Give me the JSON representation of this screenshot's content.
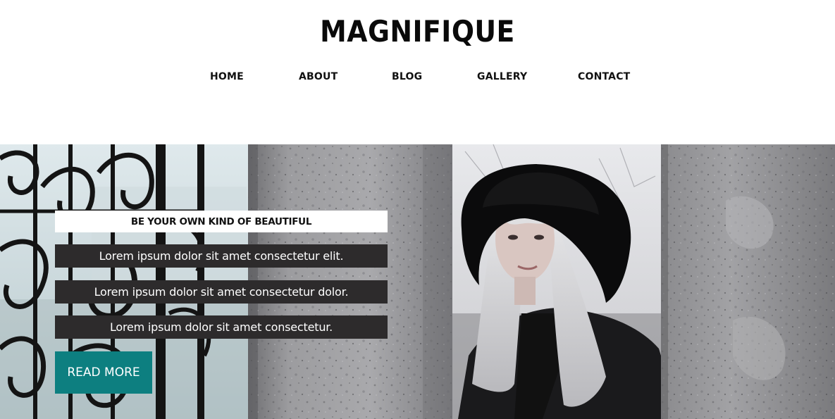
{
  "site": {
    "logo": "MAGNIFIQUE"
  },
  "nav": {
    "items": [
      "HOME",
      "ABOUT",
      "BLOG",
      "GALLERY",
      "CONTACT"
    ]
  },
  "hero": {
    "tagline": "BE YOUR OWN KIND OF BEAUTIFUL",
    "lines": [
      "Lorem ipsum dolor sit amet consectetur elit.",
      "Lorem ipsum dolor sit amet consectetur dolor.",
      "Lorem ipsum dolor sit amet consectetur."
    ],
    "button_label": "READ MORE"
  },
  "colors": {
    "accent": "#0d7f80",
    "text_band": "#2d2b2c",
    "tagline_band": "#ffffff"
  }
}
